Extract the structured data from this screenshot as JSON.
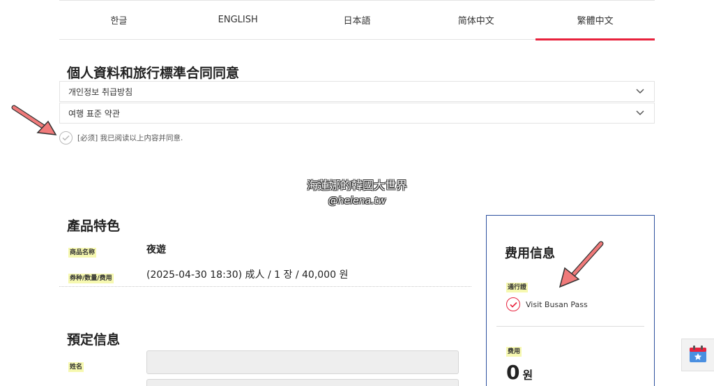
{
  "language_tabs": [
    {
      "label": "한글",
      "active": false
    },
    {
      "label": "ENGLISH",
      "active": false
    },
    {
      "label": "日本語",
      "active": false
    },
    {
      "label": "简体中文",
      "active": false
    },
    {
      "label": "繁體中文",
      "active": true
    }
  ],
  "terms": {
    "title": "個人資料和旅行標準合同同意",
    "items": [
      {
        "label": "개인정보 취급방침"
      },
      {
        "label": "여행 표준 약관"
      }
    ],
    "agree_text": "[必须] 我已阅读以上内容并同意."
  },
  "watermark": {
    "line1": "海蓮娜的韓國大世界",
    "line2": "@helena.tw"
  },
  "product": {
    "title": "產品特色",
    "name_label": "商品名称",
    "name_value": "夜遊",
    "ticket_label": "券种/数量/费用",
    "ticket_value": "(2025-04-30 18:30) 成人 / 1 장 / 40,000 원"
  },
  "booking": {
    "title": "預定信息",
    "name_label": "姓名"
  },
  "price": {
    "title": "费用信息",
    "pass_label": "通行證",
    "pass_name": "Visit Busan Pass",
    "fee_label": "费用",
    "amount": "0",
    "currency": "원"
  },
  "colors": {
    "accent_red": "#e8223d",
    "box_border_blue": "#2c4f9e",
    "tag_bg": "#f6f8b0",
    "arrow_pink": "#f07a7a"
  },
  "icons": {
    "chevron": "chevron-down-icon",
    "check": "check-circle-icon",
    "calendar": "calendar-star-icon",
    "arrow": "arrow-annotation-icon"
  }
}
